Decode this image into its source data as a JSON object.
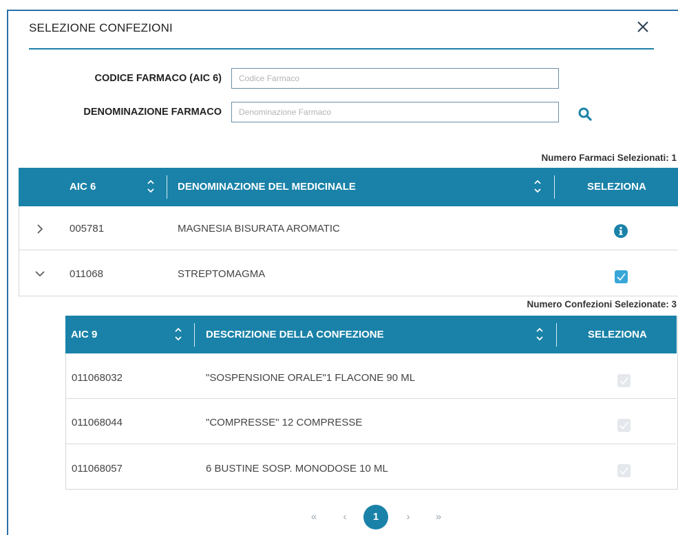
{
  "dialog": {
    "title": "SELEZIONE CONFEZIONI"
  },
  "form": {
    "codice_label": "CODICE FARMACO (AIC 6)",
    "codice_placeholder": "Codice Farmaco",
    "codice_value": "",
    "denominazione_label": "DENOMINAZIONE FARMACO",
    "denominazione_placeholder": "Denominazione Farmaco",
    "denominazione_value": ""
  },
  "farmaci": {
    "count_label": "Numero Farmaci Selezionati: 1",
    "columns": [
      "AIC 6",
      "DENOMINAZIONE DEL MEDICINALE",
      "SELEZIONA"
    ],
    "rows": [
      {
        "aic": "005781",
        "name": "MAGNESIA BISURATA AROMATIC",
        "expanded": false,
        "selection": "info"
      },
      {
        "aic": "011068",
        "name": "STREPTOMAGMA",
        "expanded": true,
        "selection": "checked"
      }
    ]
  },
  "confezioni": {
    "count_label": "Numero Confezioni Selezionate: 3",
    "columns": [
      "AIC 9",
      "DESCRIZIONE DELLA CONFEZIONE",
      "SELEZIONA"
    ],
    "rows": [
      {
        "aic": "011068032",
        "description": "\"SOSPENSIONE ORALE\"1 FLACONE 90 ML",
        "checked": true,
        "disabled": true
      },
      {
        "aic": "011068044",
        "description": "\"COMPRESSE\" 12 COMPRESSE",
        "checked": true,
        "disabled": true
      },
      {
        "aic": "011068057",
        "description": "6 BUSTINE SOSP. MONODOSE 10 ML",
        "checked": true,
        "disabled": true
      }
    ]
  },
  "pagination": {
    "first": "«",
    "prev": "‹",
    "current": "1",
    "next": "›",
    "last": "»"
  },
  "colors": {
    "accent": "#1a82a8",
    "checkbox": "#38a7d7",
    "frame": "#2b6fa8"
  }
}
